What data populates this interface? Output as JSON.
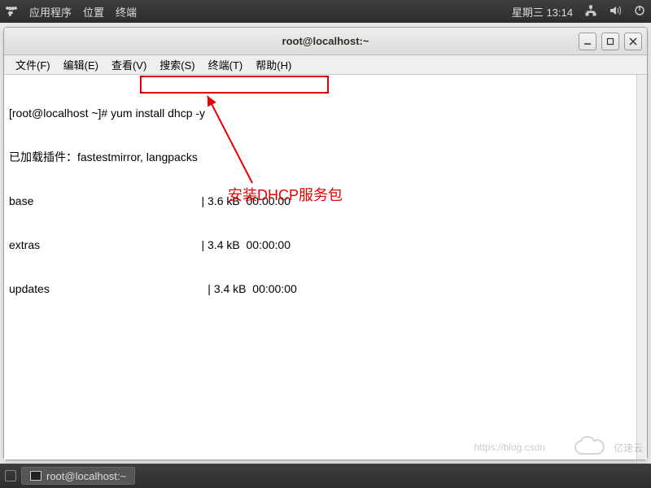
{
  "top_panel": {
    "apps": "应用程序",
    "places": "位置",
    "terminal": "终端",
    "datetime": "星期三 13:14"
  },
  "window": {
    "title": "root@localhost:~"
  },
  "menubar": {
    "file": "文件(F)",
    "edit": "编辑(E)",
    "view": "查看(V)",
    "search": "搜索(S)",
    "terminal": "终端(T)",
    "help": "帮助(H)"
  },
  "terminal": {
    "prompt": "[root@localhost ~]# ",
    "command": "yum install dhcp -y",
    "line2": "已加载插件：fastestmirror, langpacks",
    "base": "base                                                     | 3.6 kB  00:00:00",
    "extras": "extras                                                   | 3.4 kB  00:00:00",
    "updates": "updates                                                  | 3.4 kB  00:00:00"
  },
  "annotation": {
    "label": "安装DHCP服务包"
  },
  "taskbar": {
    "item": "root@localhost:~"
  },
  "watermark": {
    "blog": "https://blog.csdn",
    "brand": "亿速云"
  }
}
